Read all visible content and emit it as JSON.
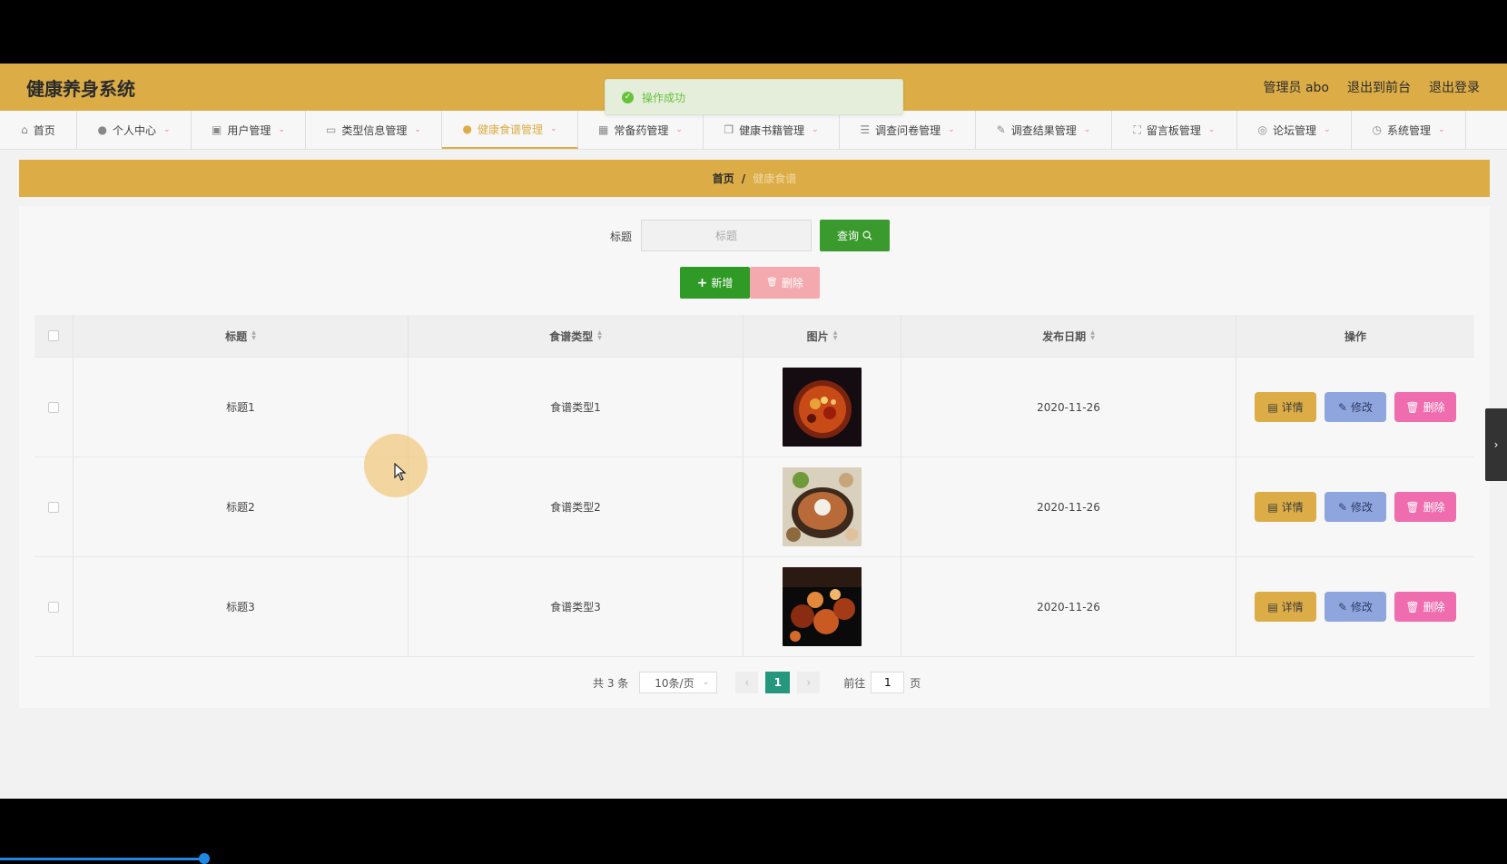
{
  "header": {
    "title": "健康养身系统",
    "links": {
      "admin": "管理员 abo",
      "to_front": "退出到前台",
      "logout": "退出登录"
    }
  },
  "toast": {
    "message": "操作成功"
  },
  "nav": [
    {
      "label": "首页",
      "icon": "home-icon",
      "glyph": "⌂",
      "arrow": ""
    },
    {
      "label": "个人中心",
      "icon": "user-icon",
      "glyph": "●",
      "arrow": "⌄"
    },
    {
      "label": "用户管理",
      "icon": "users-icon",
      "glyph": "▣",
      "arrow": "⌄"
    },
    {
      "label": "类型信息管理",
      "icon": "card-icon",
      "glyph": "▭",
      "arrow": "⌄"
    },
    {
      "label": "健康食谱管理",
      "icon": "user-icon",
      "glyph": "●",
      "arrow": "⌄",
      "active": true
    },
    {
      "label": "常备药管理",
      "icon": "grid-icon",
      "glyph": "▦",
      "arrow": "⌄"
    },
    {
      "label": "健康书籍管理",
      "icon": "copy-icon",
      "glyph": "❐",
      "arrow": "⌄"
    },
    {
      "label": "调查问卷管理",
      "icon": "list-icon",
      "glyph": "☰",
      "arrow": "⌄"
    },
    {
      "label": "调查结果管理",
      "icon": "edit-icon",
      "glyph": "✎",
      "arrow": "⌄"
    },
    {
      "label": "留言板管理",
      "icon": "expand-icon",
      "glyph": "⛶",
      "arrow": "⌄"
    },
    {
      "label": "论坛管理",
      "icon": "circle-icon",
      "glyph": "◎",
      "arrow": "⌄"
    },
    {
      "label": "系统管理",
      "icon": "clock-icon",
      "glyph": "◷",
      "arrow": "⌄"
    }
  ],
  "breadcrumb": {
    "home": "首页",
    "separator": "/",
    "current": "健康食谱"
  },
  "search": {
    "label": "标题",
    "placeholder": "标题",
    "value": "",
    "button": "查询"
  },
  "actions": {
    "add": "新增",
    "batch_delete": "删除"
  },
  "table": {
    "headers": {
      "title": "标题",
      "type": "食谱类型",
      "image": "图片",
      "date": "发布日期",
      "ops": "操作"
    },
    "rows": [
      {
        "title": "标题1",
        "type": "食谱类型1",
        "date": "2020-11-26"
      },
      {
        "title": "标题2",
        "type": "食谱类型2",
        "date": "2020-11-26"
      },
      {
        "title": "标题3",
        "type": "食谱类型3",
        "date": "2020-11-26"
      }
    ],
    "op_labels": {
      "detail": "详情",
      "edit": "修改",
      "delete": "删除"
    }
  },
  "pagination": {
    "total": "共 3 条",
    "page_size": "10条/页",
    "current_page": "1",
    "goto_prefix": "前往",
    "goto_value": "1",
    "goto_suffix": "页"
  },
  "colors": {
    "brand": "#dcad47",
    "success": "#67c23a",
    "query": "#3a9a2d",
    "add": "#2f9a26",
    "edit": "#8ea5dd",
    "delete": "#ef6cae",
    "page_active": "#25977d"
  }
}
